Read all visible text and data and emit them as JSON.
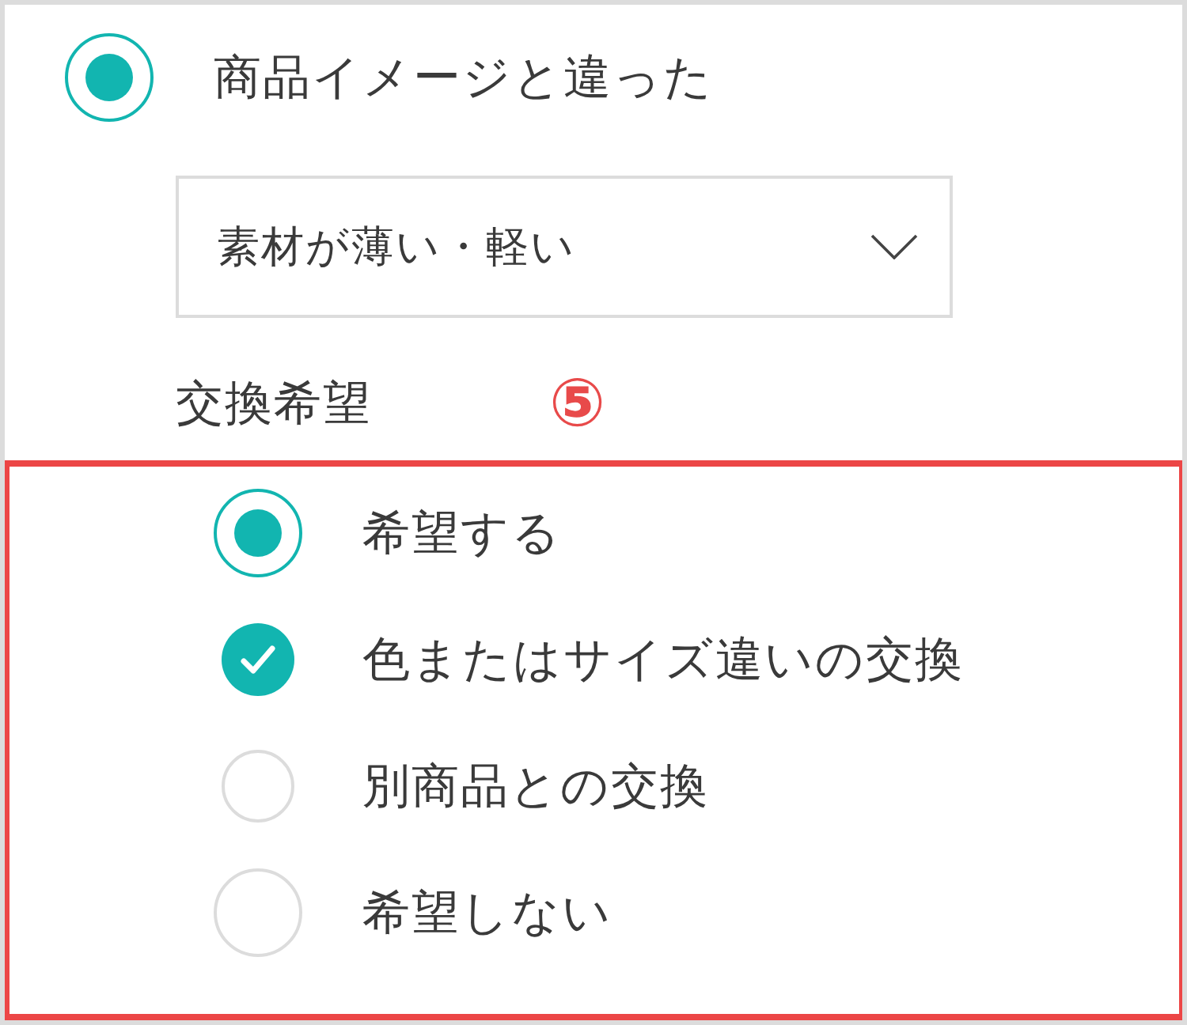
{
  "reason": {
    "label": "商品イメージと違った",
    "selected": true
  },
  "reason_detail": {
    "value": "素材が薄い・軽い"
  },
  "exchange": {
    "label": "交換希望",
    "annotation": "⑤",
    "options": [
      {
        "kind": "radio",
        "label": "希望する",
        "selected": true
      },
      {
        "kind": "checkbox",
        "label": "色またはサイズ違いの交換",
        "checked": true
      },
      {
        "kind": "checkbox",
        "label": "別商品との交換",
        "checked": false
      },
      {
        "kind": "radio",
        "label": "希望しない",
        "selected": false
      }
    ]
  }
}
